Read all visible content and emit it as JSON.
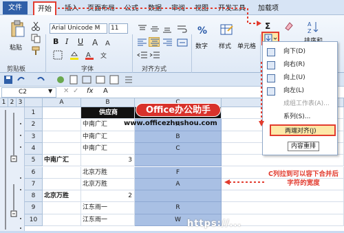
{
  "ribbon_tabs": [
    "文件",
    "开始",
    "插入",
    "页面布局",
    "公式",
    "数据",
    "审阅",
    "视图",
    "开发工具",
    "加载项"
  ],
  "ribbon": {
    "paste_label": "粘贴",
    "font_name": "Arial Unicode M",
    "font_size": "11",
    "groups": {
      "clipboard": "剪贴板",
      "font": "字体",
      "alignment": "对齐方式",
      "number": "数字",
      "styles": "样式",
      "cells": "单元格"
    },
    "bold": "B",
    "italic": "I",
    "underline": "U",
    "sigma": "Σ",
    "sort_label": "排序和"
  },
  "formula_bar": {
    "cell_ref": "C2",
    "fx": "fx",
    "value": "A"
  },
  "columns": [
    "A",
    "B",
    "C",
    "D"
  ],
  "outline_levels": [
    "1",
    "2",
    "3"
  ],
  "rows": [
    {
      "n": "1",
      "a": "",
      "b": "供应商",
      "c": "",
      "c_bold": false
    },
    {
      "n": "2",
      "a": "",
      "b": "中南广汇",
      "c": "A"
    },
    {
      "n": "3",
      "a": "",
      "b": "中南广汇",
      "c": "B"
    },
    {
      "n": "4",
      "a": "",
      "b": "中南广汇",
      "c": "C"
    },
    {
      "n": "5",
      "a": "中南广汇",
      "b": "3",
      "c": ""
    },
    {
      "n": "6",
      "a": "",
      "b": "北京万胜",
      "c": "F"
    },
    {
      "n": "7",
      "a": "",
      "b": "北京万胜",
      "c": "A"
    },
    {
      "n": "8",
      "a": "北京万胜",
      "b": "2",
      "c": ""
    },
    {
      "n": "9",
      "a": "",
      "b": "江东雨一",
      "c": "R"
    },
    {
      "n": "10",
      "a": "",
      "b": "江东雨一",
      "c": "W"
    }
  ],
  "fill_menu": {
    "items": [
      "向下(D)",
      "向右(R)",
      "向上(U)",
      "向左(L)",
      "成组工作表(A)...",
      "系列(S)...",
      "两端对齐(J)"
    ],
    "tooltip": "内容重排"
  },
  "overlay": {
    "banner": "Office办公助手",
    "url": "www.officezhushou.com",
    "annotation": "C列拉到可以容下合并后字符的宽度",
    "watermark": "https://..."
  },
  "colors": {
    "accent_red": "#e23b2e",
    "selection_blue": "#a9c0e4",
    "file_tab_blue": "#2f5fa8"
  }
}
